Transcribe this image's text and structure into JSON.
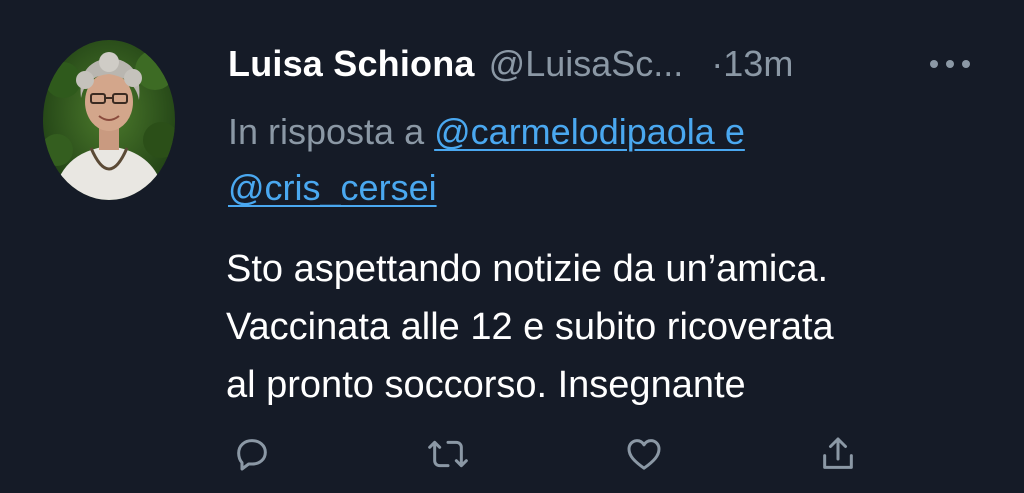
{
  "tweet": {
    "author_name": "Luisa Schiona",
    "author_handle": "@LuisaSc...",
    "timestamp": "·13m",
    "reply_prefix": "In risposta a",
    "mentions": [
      "@carmelodipaola e",
      "@cris_cersei"
    ],
    "text_lines": [
      "Sto aspettando notizie da un’amica.",
      "Vaccinata alle 12 e subito ricoverata",
      "al pronto soccorso. Insegnante"
    ]
  },
  "actions": {
    "reply_icon": "reply-icon",
    "retweet_icon": "retweet-icon",
    "like_icon": "heart-icon",
    "share_icon": "share-icon"
  },
  "colors": {
    "background": "#151b27",
    "text": "#ffffff",
    "muted": "#8b98a5",
    "link": "#4aa8f0"
  }
}
